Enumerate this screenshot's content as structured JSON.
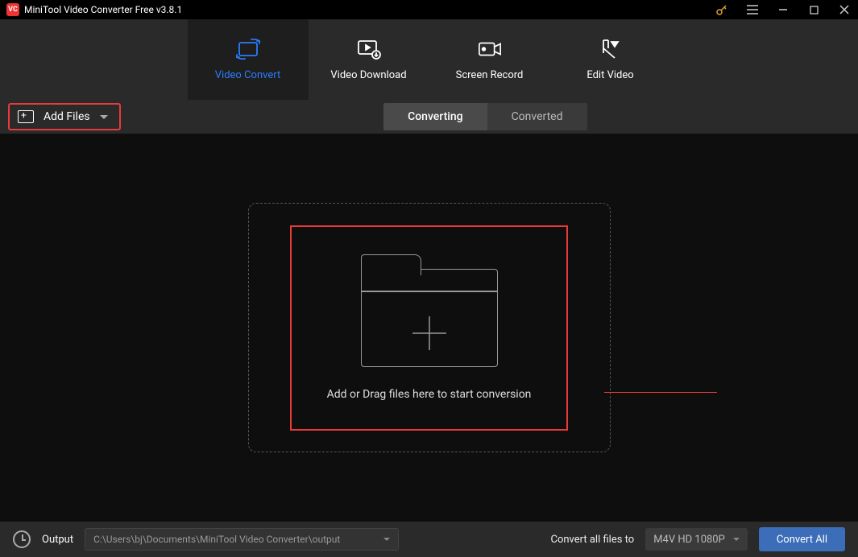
{
  "titlebar": {
    "logo_text": "VC",
    "title": "MiniTool Video Converter Free v3.8.1"
  },
  "tabs": [
    {
      "label": "Video Convert",
      "icon": "convert-icon",
      "active": true
    },
    {
      "label": "Video Download",
      "icon": "download-icon",
      "active": false
    },
    {
      "label": "Screen Record",
      "icon": "record-icon",
      "active": false
    },
    {
      "label": "Edit Video",
      "icon": "edit-icon",
      "active": false
    }
  ],
  "toolbar": {
    "add_files_label": "Add Files",
    "segment": {
      "converting": "Converting",
      "converted": "Converted"
    }
  },
  "dropzone": {
    "text": "Add or Drag files here to start conversion"
  },
  "footer": {
    "output_label": "Output",
    "output_path": "C:\\Users\\bj\\Documents\\MiniTool Video Converter\\output",
    "convert_all_label": "Convert all files to",
    "format_selected": "M4V HD 1080P",
    "convert_all_button": "Convert All"
  }
}
